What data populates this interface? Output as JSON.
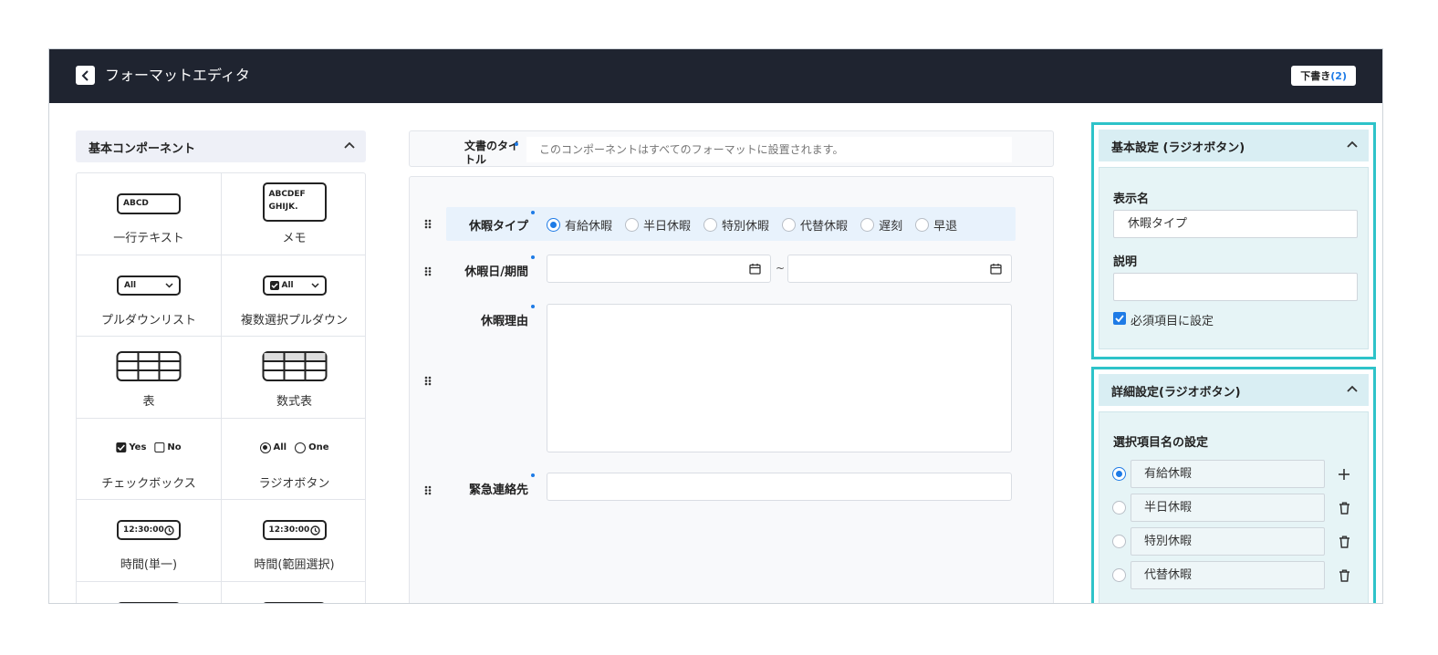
{
  "header": {
    "title": "フォーマットエディタ",
    "draft_label": "下書き",
    "draft_count": "(2)"
  },
  "palette": {
    "title": "基本コンポーネント",
    "items": [
      {
        "label": "一行テキスト",
        "icon_text": "ABCD"
      },
      {
        "label": "メモ",
        "icon_text": "ABCDEF GHIJK."
      },
      {
        "label": "プルダウンリスト",
        "icon_text": "All"
      },
      {
        "label": "複数選択プルダウン",
        "icon_text": "All"
      },
      {
        "label": "表",
        "icon_text": ""
      },
      {
        "label": "数式表",
        "icon_text": ""
      },
      {
        "label": "チェックボックス",
        "icon_text": "Yes No"
      },
      {
        "label": "ラジオボタン",
        "icon_text": "All One"
      },
      {
        "label": "時間(単一)",
        "icon_text": "12:30:00"
      },
      {
        "label": "時間(範囲選択)",
        "icon_text": "12:30:00"
      }
    ],
    "icon_words": {
      "abcd": "ABCD",
      "memo1": "ABCDEF",
      "memo2": "GHIJK.",
      "all": "All",
      "yes": "Yes",
      "no": "No",
      "one": "One",
      "time": "12:30:00"
    }
  },
  "form": {
    "doc_title_label": "文書のタイトル",
    "doc_title_placeholder": "このコンポーネントはすべてのフォーマットに設置されます。",
    "leave_type_label": "休暇タイプ",
    "leave_type_options": [
      "有給休暇",
      "半日休暇",
      "特別休暇",
      "代替休暇",
      "遅刻",
      "早退"
    ],
    "leave_type_selected": "有給休暇",
    "leave_date_label": "休暇日/期間",
    "date_separator": "~",
    "reason_label": "休暇理由",
    "contact_label": "緊急連絡先"
  },
  "basic_settings": {
    "title": "基本設定 (ラジオボタン)",
    "display_name_label": "表示名",
    "display_name_value": "休暇タイプ",
    "description_label": "説明",
    "description_value": "",
    "required_label": "必須項目に設定",
    "required_checked": true
  },
  "detail_settings": {
    "title": "詳細設定(ラジオボタン)",
    "option_names_label": "選択項目名の設定",
    "options": [
      "有給休暇",
      "半日休暇",
      "特別休暇",
      "代替休暇"
    ],
    "selected_index": 0
  },
  "colors": {
    "topbar": "#1f2430",
    "accent": "#1e7be6",
    "highlight_border": "#2ec3c9"
  }
}
